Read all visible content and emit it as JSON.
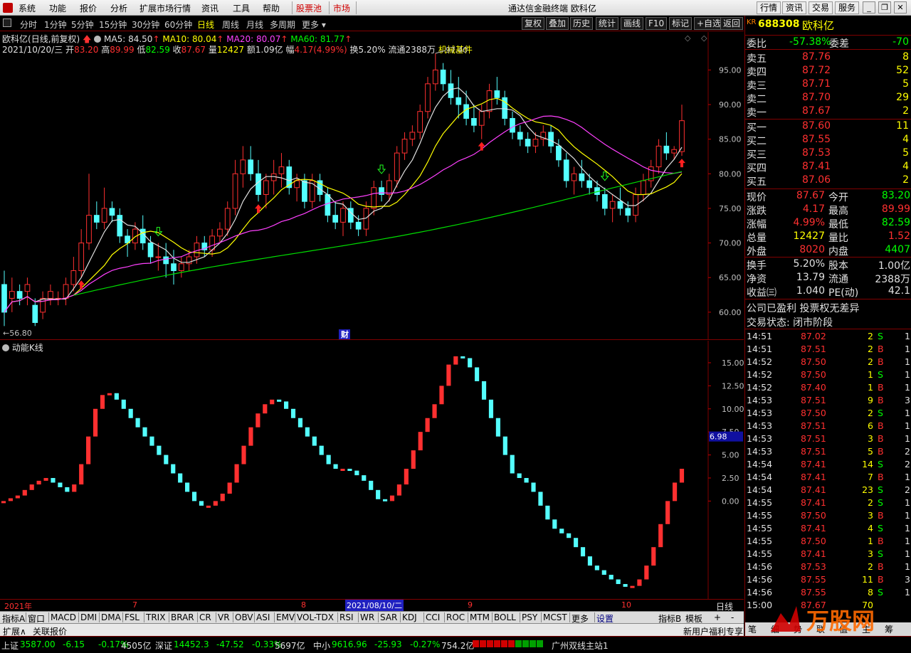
{
  "menu": {
    "items": [
      "系统",
      "功能",
      "报价",
      "分析",
      "扩展市场行情",
      "资讯",
      "工具",
      "帮助"
    ],
    "highlight": [
      "股票池",
      "市场"
    ],
    "title": "通达信金融终端 欧科亿",
    "right_buttons": [
      "行情",
      "资讯",
      "交易",
      "服务"
    ]
  },
  "toolbar": {
    "periods": [
      "分时",
      "1分钟",
      "5分钟",
      "15分钟",
      "30分钟",
      "60分钟",
      "日线",
      "周线",
      "月线",
      "多周期",
      "更多"
    ],
    "active": "日线",
    "right_buttons": [
      "复权",
      "叠加",
      "历史",
      "统计",
      "画线",
      "F10",
      "标记",
      "+自选",
      "返回"
    ]
  },
  "info": {
    "name": "欧科亿",
    "mode": "(日线,前复权)",
    "ma": [
      {
        "label": "MA5: 84.50",
        "color": "#e0e0e0"
      },
      {
        "label": "MA10: 80.04",
        "color": "#ffff00"
      },
      {
        "label": "MA20: 80.07",
        "color": "#ff40ff"
      },
      {
        "label": "MA60: 81.77",
        "color": "#00ff00"
      }
    ],
    "date": "2021/10/20/三",
    "open_l": "开",
    "open": "83.20",
    "high_l": "高",
    "high": "89.99",
    "low_l": "低",
    "low": "82.59",
    "close_l": "收",
    "close": "87.67",
    "vol_l": "量",
    "vol": "12427",
    "amt_l": "额",
    "amt": "1.09亿",
    "chg_l": "幅",
    "chg": "4.17(4.99%)",
    "turn": "换5.20%",
    "float": "流通2388万",
    "industry": "机械基件"
  },
  "main_annotations": {
    "high_label": "97.40",
    "low_label": "←56.80",
    "cai": "财"
  },
  "sub": {
    "title": "动能K线",
    "value_tag": "6.98"
  },
  "dates": [
    "2021年",
    "7",
    "8",
    "2021/08/10/二",
    "9",
    "10"
  ],
  "date_right": "日线",
  "tabs": [
    "指标A",
    "窗口",
    "MACD",
    "DMI",
    "DMA",
    "FSL",
    "TRIX",
    "BRAR",
    "CR",
    "VR",
    "OBV",
    "ASI",
    "EMV",
    "VOL-TDX",
    "RSI",
    "WR",
    "SAR",
    "KDJ",
    "CCI",
    "ROC",
    "MTM",
    "BOLL",
    "PSY",
    "MCST",
    "更多",
    "设置"
  ],
  "tabs_right": [
    "指标B",
    "模板",
    "+",
    "-"
  ],
  "tabs2": [
    "扩展∧",
    "关联报价"
  ],
  "tabs2_right": "新用户福利专享",
  "quote": {
    "code_badge": "KR",
    "code": "688308",
    "name": "欧科亿",
    "wb_label": "委比",
    "wb": "-57.38%",
    "wc_label": "委差",
    "wc": "-70",
    "sell": [
      {
        "l": "卖五",
        "p": "87.76",
        "v": "8"
      },
      {
        "l": "卖四",
        "p": "87.72",
        "v": "52"
      },
      {
        "l": "卖三",
        "p": "87.71",
        "v": "5"
      },
      {
        "l": "卖二",
        "p": "87.70",
        "v": "29"
      },
      {
        "l": "卖一",
        "p": "87.67",
        "v": "2"
      }
    ],
    "buy": [
      {
        "l": "买一",
        "p": "87.60",
        "v": "11"
      },
      {
        "l": "买二",
        "p": "87.55",
        "v": "4"
      },
      {
        "l": "买三",
        "p": "87.53",
        "v": "5"
      },
      {
        "l": "买四",
        "p": "87.41",
        "v": "4"
      },
      {
        "l": "买五",
        "p": "87.06",
        "v": "2"
      }
    ],
    "stats": [
      {
        "l1": "现价",
        "v1": "87.67",
        "c1": "#ff3030",
        "l2": "今开",
        "v2": "83.20",
        "c2": "#00ff00"
      },
      {
        "l1": "涨跌",
        "v1": "4.17",
        "c1": "#ff3030",
        "l2": "最高",
        "v2": "89.99",
        "c2": "#ff3030"
      },
      {
        "l1": "涨幅",
        "v1": "4.99%",
        "c1": "#ff3030",
        "l2": "最低",
        "v2": "82.59",
        "c2": "#00ff00"
      },
      {
        "l1": "总量",
        "v1": "12427",
        "c1": "#ffff00",
        "l2": "量比",
        "v2": "1.52",
        "c2": "#ff3030"
      },
      {
        "l1": "外盘",
        "v1": "8020",
        "c1": "#ff3030",
        "l2": "内盘",
        "v2": "4407",
        "c2": "#00ff00"
      }
    ],
    "stats2": [
      {
        "l1": "换手",
        "v1": "5.20%",
        "l2": "股本",
        "v2": "1.00亿"
      },
      {
        "l1": "净资",
        "v1": "13.79",
        "l2": "流通",
        "v2": "2388万"
      },
      {
        "l1": "收益㈢",
        "v1": "1.040",
        "l2": "PE(动)",
        "v2": "42.1"
      }
    ],
    "notes": [
      "公司已盈利 投票权无差异",
      "交易状态: 闭市阶段"
    ],
    "ticks": [
      [
        "14:51",
        "87.02",
        "2",
        "S",
        "1"
      ],
      [
        "14:51",
        "87.51",
        "2",
        "B",
        "1"
      ],
      [
        "14:52",
        "87.50",
        "2",
        "B",
        "1"
      ],
      [
        "14:52",
        "87.50",
        "1",
        "S",
        "1"
      ],
      [
        "14:52",
        "87.40",
        "1",
        "B",
        "1"
      ],
      [
        "14:53",
        "87.51",
        "9",
        "B",
        "3"
      ],
      [
        "14:53",
        "87.50",
        "2",
        "S",
        "1"
      ],
      [
        "14:53",
        "87.51",
        "6",
        "B",
        "1"
      ],
      [
        "14:53",
        "87.51",
        "3",
        "B",
        "1"
      ],
      [
        "14:53",
        "87.51",
        "5",
        "B",
        "2"
      ],
      [
        "14:54",
        "87.41",
        "14",
        "S",
        "2"
      ],
      [
        "14:54",
        "87.41",
        "7",
        "B",
        "1"
      ],
      [
        "14:54",
        "87.41",
        "23",
        "S",
        "2"
      ],
      [
        "14:55",
        "87.41",
        "2",
        "S",
        "1"
      ],
      [
        "14:55",
        "87.50",
        "3",
        "B",
        "1"
      ],
      [
        "14:55",
        "87.41",
        "4",
        "S",
        "1"
      ],
      [
        "14:55",
        "87.50",
        "1",
        "B",
        "1"
      ],
      [
        "14:55",
        "87.41",
        "3",
        "S",
        "1"
      ],
      [
        "14:56",
        "87.53",
        "2",
        "B",
        "1"
      ],
      [
        "14:56",
        "87.55",
        "11",
        "B",
        "3"
      ],
      [
        "14:56",
        "87.55",
        "8",
        "S",
        "1"
      ],
      [
        "15:00",
        "87.67",
        "70",
        "",
        ""
      ]
    ],
    "bottom_tabs": [
      "笔",
      "细",
      "势",
      "联",
      "值",
      "主",
      "筹"
    ]
  },
  "status": {
    "items": [
      {
        "name": "上证",
        "val": "3587.00",
        "chg": "-6.15",
        "pct": "-0.17%",
        "amt": "4505亿"
      },
      {
        "name": "深证",
        "val": "14452.3",
        "chg": "-47.52",
        "pct": "-0.33%",
        "amt": "5697亿"
      },
      {
        "name": "中小",
        "val": "9616.96",
        "chg": "-25.93",
        "pct": "-0.27%",
        "amt": "754.2亿"
      }
    ],
    "server": "广州双线主站1"
  },
  "colors": {
    "up": "#ff3030",
    "down": "#54ffff",
    "ma5": "#e0e0e0",
    "ma10": "#ffff00",
    "ma20": "#ff40ff",
    "ma60": "#00dd00",
    "grid_border": "#800000"
  },
  "chart_data": [
    {
      "type": "candlestick",
      "title": "欧科亿(日线,前复权)",
      "ylim": [
        56.8,
        97.4
      ],
      "yticks": [
        60,
        65,
        70,
        75,
        80,
        85,
        90,
        95
      ],
      "x_labels": [
        "2021年",
        "7",
        "8",
        "9",
        "10"
      ],
      "candles": [
        [
          64,
          66,
          58,
          60
        ],
        [
          62,
          65,
          60,
          63
        ],
        [
          63,
          64,
          61,
          62
        ],
        [
          63,
          65,
          61,
          64
        ],
        [
          61,
          62,
          58,
          58.5
        ],
        [
          60,
          63,
          59,
          62
        ],
        [
          62,
          64,
          61,
          63
        ],
        [
          62,
          63,
          61,
          62
        ],
        [
          62,
          65,
          61,
          64
        ],
        [
          64,
          68,
          63,
          66
        ],
        [
          66,
          72,
          65,
          70
        ],
        [
          70,
          80,
          69,
          74
        ],
        [
          74,
          76,
          72,
          73
        ],
        [
          73,
          78,
          72,
          75
        ],
        [
          75,
          76,
          73,
          74
        ],
        [
          74,
          75,
          70,
          71
        ],
        [
          71,
          72,
          68,
          70
        ],
        [
          70,
          73,
          69,
          72
        ],
        [
          72,
          74,
          69,
          70
        ],
        [
          70,
          71,
          67,
          68
        ],
        [
          68,
          70,
          66,
          68
        ],
        [
          68,
          70,
          65,
          67
        ],
        [
          67,
          69,
          64,
          66
        ],
        [
          66,
          68,
          65,
          67
        ],
        [
          67,
          69,
          66,
          68
        ],
        [
          68,
          71,
          67,
          70
        ],
        [
          70,
          71,
          68,
          69
        ],
        [
          69,
          72,
          68,
          71
        ],
        [
          71,
          73,
          70,
          72
        ],
        [
          72,
          76,
          71,
          75
        ],
        [
          75,
          82,
          74,
          80
        ],
        [
          80,
          84,
          78,
          82
        ],
        [
          82,
          84,
          79,
          80
        ],
        [
          80,
          82,
          76,
          77
        ],
        [
          77,
          80,
          75,
          79
        ],
        [
          79,
          82,
          77,
          80
        ],
        [
          80,
          83,
          78,
          81
        ],
        [
          81,
          82,
          77,
          78
        ],
        [
          78,
          80,
          76,
          79
        ],
        [
          79,
          80,
          75,
          76
        ],
        [
          76,
          80,
          75,
          79
        ],
        [
          79,
          80,
          76,
          77
        ],
        [
          77,
          78,
          73,
          74
        ],
        [
          74,
          76,
          72,
          73
        ],
        [
          73,
          76,
          71,
          75
        ],
        [
          75,
          76,
          72,
          73
        ],
        [
          73,
          74,
          71,
          72
        ],
        [
          72,
          76,
          71,
          75
        ],
        [
          75,
          79,
          74,
          78
        ],
        [
          78,
          79,
          76,
          77
        ],
        [
          77,
          80,
          76,
          79
        ],
        [
          79,
          84,
          78,
          83
        ],
        [
          83,
          86,
          82,
          85
        ],
        [
          85,
          87,
          84,
          86
        ],
        [
          86,
          90,
          85,
          89
        ],
        [
          89,
          94,
          88,
          93
        ],
        [
          93,
          97.4,
          92,
          95
        ],
        [
          95,
          96,
          92,
          93
        ],
        [
          93,
          95,
          90,
          91
        ],
        [
          91,
          94,
          88,
          90
        ],
        [
          90,
          92,
          87,
          88
        ],
        [
          88,
          90,
          86,
          87
        ],
        [
          87,
          90,
          85,
          89
        ],
        [
          89,
          93,
          88,
          92
        ],
        [
          92,
          94,
          90,
          91
        ],
        [
          91,
          92,
          87,
          88
        ],
        [
          88,
          89,
          85,
          86
        ],
        [
          86,
          87,
          84,
          85
        ],
        [
          85,
          86,
          83,
          84
        ],
        [
          84,
          86,
          83,
          85
        ],
        [
          85,
          87,
          84,
          86
        ],
        [
          86,
          87,
          83,
          84
        ],
        [
          84,
          85,
          81,
          82
        ],
        [
          82,
          83,
          78,
          79
        ],
        [
          79,
          81,
          77,
          80
        ],
        [
          80,
          82,
          78,
          79
        ],
        [
          79,
          80,
          77,
          78
        ],
        [
          78,
          79,
          76,
          77
        ],
        [
          77,
          78,
          74,
          75
        ],
        [
          75,
          77,
          73,
          76
        ],
        [
          76,
          78,
          74,
          75
        ],
        [
          75,
          76,
          73,
          74
        ],
        [
          74,
          78,
          73,
          77
        ],
        [
          77,
          80,
          76,
          79
        ],
        [
          79,
          82,
          78,
          81
        ],
        [
          81,
          85,
          80,
          84
        ],
        [
          84,
          86,
          82,
          83
        ],
        [
          83,
          84,
          82,
          83.5
        ],
        [
          83.2,
          89.99,
          82.59,
          87.67
        ]
      ],
      "series": [
        {
          "name": "MA5",
          "values": [
            84.5
          ]
        },
        {
          "name": "MA10",
          "values": [
            80.04
          ]
        },
        {
          "name": "MA20",
          "values": [
            80.07
          ]
        },
        {
          "name": "MA60",
          "values": [
            81.77
          ]
        }
      ]
    },
    {
      "type": "bar",
      "title": "动能K线",
      "ylim": [
        -10,
        16
      ],
      "yticks": [
        0,
        2.5,
        5,
        7.5,
        10,
        12.5,
        15
      ],
      "values": [
        0,
        0.3,
        0.6,
        1.2,
        1.8,
        2.2,
        2.5,
        2.0,
        1.5,
        1.0,
        1.8,
        4,
        7,
        10,
        11.5,
        11.7,
        11,
        10,
        9,
        8,
        7,
        6,
        5,
        4,
        3,
        2,
        1,
        0,
        -0.5,
        -0.5,
        0,
        0.8,
        2,
        4,
        6,
        8,
        9.5,
        10.5,
        11,
        10.8,
        10,
        9,
        8,
        7,
        6,
        5,
        4,
        3.5,
        3.5,
        3.3,
        2.8,
        2.2,
        1.2,
        0.2,
        0,
        0.6,
        1.8,
        3.5,
        5.5,
        7.5,
        9,
        10.5,
        12.5,
        14.8,
        15.7,
        15.5,
        14.5,
        13,
        11,
        9,
        7,
        5,
        3,
        2.5,
        2,
        1,
        -0.5,
        -2,
        -3,
        -3.5,
        -4,
        -5,
        -6,
        -7,
        -7.5,
        -8,
        -8.5,
        -9,
        -9.3,
        -9.2,
        -8.5,
        -7,
        -5,
        -2.5,
        0,
        2,
        3.5
      ]
    }
  ]
}
